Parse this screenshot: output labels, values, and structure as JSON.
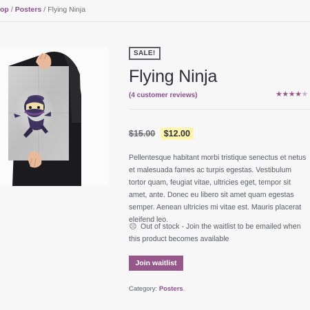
{
  "breadcrumb": {
    "shop": "op",
    "sep1": "/",
    "category": "Posters",
    "sep2": "/",
    "current": "Flying Ninja"
  },
  "product": {
    "badge": "SALE!",
    "title": "Flying Ninja",
    "reviews_link": "(4 customer reviews)",
    "rating": 4,
    "rating_max": 5,
    "price_old": "$15.00",
    "price_new": "$12.00",
    "description": "Pellentesque habitant morbi tristique senectus et netus et malesuada fames ac turpis egestas. Vestibulum tortor quam, feugiat vitae, ultricies eget, tempor sit amet, ante. Donec eu libero sit amet quam egestas semper. Aenean ultricies mi vitae est. Mauris placerat eleifend leo.",
    "stock_icon": "sad-face-icon",
    "stock_text": "Out of stock - Join the waitlist to be emailed when this product becomes available",
    "waitlist_button": "Join waitlist",
    "category_label": "Category:",
    "category_value": "Posters",
    "category_end": "."
  },
  "colors": {
    "accent": "#96588a",
    "link": "#8a4f8e",
    "price_highlight": "#fff6b0",
    "text": "#43454b",
    "background": "#f7f7f8"
  }
}
